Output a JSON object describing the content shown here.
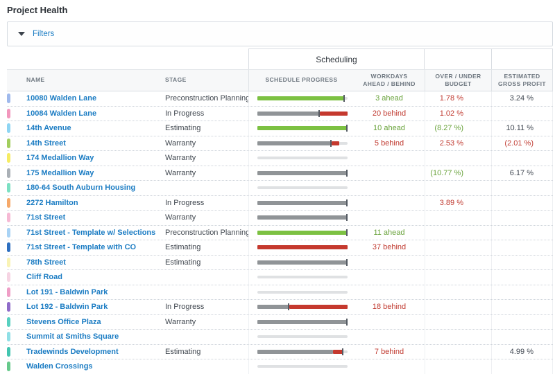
{
  "page": {
    "title": "Project Health"
  },
  "filters": {
    "label": "Filters"
  },
  "table": {
    "group_header": "Scheduling",
    "columns": {
      "name": "NAME",
      "stage": "STAGE",
      "progress": "SCHEDULE PROGRESS",
      "workdays": "WORKDAYS\nAHEAD / BEHIND",
      "budget": "OVER / UNDER\nBUDGET",
      "profit": "ESTIMATED\nGROSS PROFIT"
    },
    "colors": {
      "bar_green": "#7cc142",
      "bar_red": "#c5392e",
      "bar_gray": "#909497",
      "bar_track": "#dfe1e3",
      "bar_marker": "#555b63",
      "link_blue": "#1b7cc3",
      "text_green": "#68a23a",
      "text_red": "#c0392f"
    },
    "rows": [
      {
        "accent": "#9fb9ec",
        "name": "10080 Walden Lane",
        "stage": "Preconstruction Planning",
        "bar": {
          "segments": [
            {
              "c": "green",
              "s": 0,
              "e": 97
            }
          ],
          "marker": 97
        },
        "workdays": {
          "text": "3 ahead",
          "tone": "green"
        },
        "budget": {
          "text": "1.78 %",
          "tone": "red"
        },
        "profit": {
          "text": "3.24 %",
          "tone": "dark"
        }
      },
      {
        "accent": "#f297bd",
        "name": "10084 Walden Lane",
        "stage": "In Progress",
        "bar": {
          "segments": [
            {
              "c": "gray",
              "s": 0,
              "e": 69
            },
            {
              "c": "red",
              "s": 69,
              "e": 100
            }
          ],
          "marker": 69
        },
        "workdays": {
          "text": "20 behind",
          "tone": "red"
        },
        "budget": {
          "text": "1.02 %",
          "tone": "red"
        },
        "profit": null
      },
      {
        "accent": "#8ed5f3",
        "name": "14th Avenue",
        "stage": "Estimating",
        "bar": {
          "segments": [
            {
              "c": "green",
              "s": 0,
              "e": 100
            }
          ],
          "marker": 100
        },
        "workdays": {
          "text": "10 ahead",
          "tone": "green"
        },
        "budget": {
          "text": "(8.27 %)",
          "tone": "green"
        },
        "profit": {
          "text": "10.11 %",
          "tone": "dark"
        }
      },
      {
        "accent": "#a2ce5e",
        "name": "14th Street",
        "stage": "Warranty",
        "bar": {
          "segments": [
            {
              "c": "gray",
              "s": 0,
              "e": 82
            },
            {
              "c": "red",
              "s": 82,
              "e": 91
            }
          ],
          "marker": 82
        },
        "workdays": {
          "text": "5 behind",
          "tone": "red"
        },
        "budget": {
          "text": "2.53 %",
          "tone": "red"
        },
        "profit": {
          "text": "(2.01 %)",
          "tone": "red"
        }
      },
      {
        "accent": "#f6ec63",
        "name": "174 Medallion Way",
        "stage": "Warranty",
        "bar": {
          "segments": [],
          "marker": null
        },
        "workdays": null,
        "budget": null,
        "profit": null
      },
      {
        "accent": "#aab0b6",
        "name": "175 Medallion Way",
        "stage": "Warranty",
        "bar": {
          "segments": [
            {
              "c": "gray",
              "s": 0,
              "e": 100
            }
          ],
          "marker": 100
        },
        "workdays": null,
        "budget": {
          "text": "(10.77 %)",
          "tone": "green"
        },
        "profit": {
          "text": "6.17 %",
          "tone": "dark"
        }
      },
      {
        "accent": "#7ce0c3",
        "name": "180-64 South Auburn Housing",
        "stage": "",
        "bar": {
          "segments": [],
          "marker": null
        },
        "workdays": null,
        "budget": null,
        "profit": null
      },
      {
        "accent": "#f6a96a",
        "name": "2272 Hamilton",
        "stage": "In Progress",
        "bar": {
          "segments": [
            {
              "c": "gray",
              "s": 0,
              "e": 100
            }
          ],
          "marker": 100
        },
        "workdays": null,
        "budget": {
          "text": "3.89 %",
          "tone": "red"
        },
        "profit": null
      },
      {
        "accent": "#f6b9d4",
        "name": "71st Street",
        "stage": "Warranty",
        "bar": {
          "segments": [
            {
              "c": "gray",
              "s": 0,
              "e": 100
            }
          ],
          "marker": 100
        },
        "workdays": null,
        "budget": null,
        "profit": null
      },
      {
        "accent": "#a9d3f5",
        "name": "71st Street - Template w/ Selections",
        "stage": "Preconstruction Planning",
        "bar": {
          "segments": [
            {
              "c": "green",
              "s": 0,
              "e": 100
            }
          ],
          "marker": 100
        },
        "workdays": {
          "text": "11 ahead",
          "tone": "green"
        },
        "budget": null,
        "profit": null
      },
      {
        "accent": "#2e6fc0",
        "name": "71st Street - Template with CO",
        "stage": "Estimating",
        "bar": {
          "segments": [
            {
              "c": "red",
              "s": 0,
              "e": 100
            }
          ],
          "marker": null
        },
        "workdays": {
          "text": "37 behind",
          "tone": "red"
        },
        "budget": null,
        "profit": null
      },
      {
        "accent": "#f9f3b5",
        "name": "78th Street",
        "stage": "Estimating",
        "bar": {
          "segments": [
            {
              "c": "gray",
              "s": 0,
              "e": 100
            }
          ],
          "marker": 100
        },
        "workdays": null,
        "budget": null,
        "profit": null
      },
      {
        "accent": "#f6d4e3",
        "name": "Cliff Road",
        "stage": "",
        "bar": {
          "segments": [],
          "marker": null
        },
        "workdays": null,
        "budget": null,
        "profit": null
      },
      {
        "accent": "#ef9ec6",
        "name": "Lot 191 - Baldwin Park",
        "stage": "",
        "bar": {
          "segments": [],
          "marker": null
        },
        "workdays": null,
        "budget": null,
        "profit": null
      },
      {
        "accent": "#8f6cc9",
        "name": "Lot 192 - Baldwin Park",
        "stage": "In Progress",
        "bar": {
          "segments": [
            {
              "c": "gray",
              "s": 0,
              "e": 35
            },
            {
              "c": "red",
              "s": 35,
              "e": 100
            }
          ],
          "marker": 35
        },
        "workdays": {
          "text": "18 behind",
          "tone": "red"
        },
        "budget": null,
        "profit": null
      },
      {
        "accent": "#58d0c0",
        "name": "Stevens Office Plaza",
        "stage": "Warranty",
        "bar": {
          "segments": [
            {
              "c": "gray",
              "s": 0,
              "e": 100
            }
          ],
          "marker": 100
        },
        "workdays": null,
        "budget": null,
        "profit": null
      },
      {
        "accent": "#8fdfe6",
        "name": "Summit at Smiths Square",
        "stage": "",
        "bar": {
          "segments": [],
          "marker": null
        },
        "workdays": null,
        "budget": null,
        "profit": null
      },
      {
        "accent": "#43c5b0",
        "name": "Tradewinds Development",
        "stage": "Estimating",
        "bar": {
          "segments": [
            {
              "c": "gray",
              "s": 0,
              "e": 84
            },
            {
              "c": "red",
              "s": 84,
              "e": 95
            }
          ],
          "marker": 95
        },
        "workdays": {
          "text": "7 behind",
          "tone": "red"
        },
        "budget": null,
        "profit": {
          "text": "4.99 %",
          "tone": "dark"
        }
      },
      {
        "accent": "#66c98b",
        "name": "Walden Crossings",
        "stage": "",
        "bar": {
          "segments": [],
          "marker": null
        },
        "workdays": null,
        "budget": null,
        "profit": null
      }
    ]
  }
}
